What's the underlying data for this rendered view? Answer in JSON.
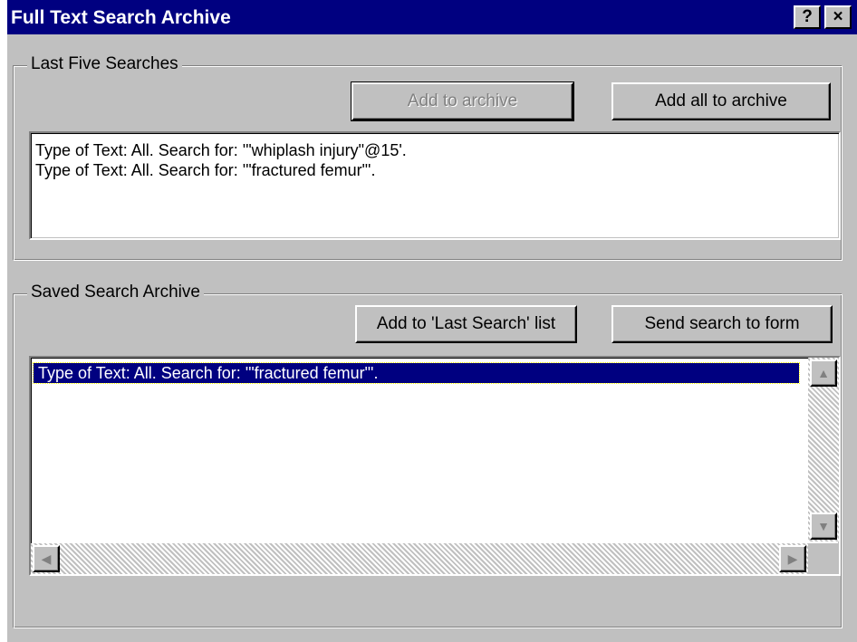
{
  "window": {
    "title": "Full Text Search Archive",
    "help_label": "?",
    "close_label": "×"
  },
  "last_searches": {
    "label": "Last Five Searches",
    "add_button": "Add to archive",
    "add_all_button": "Add all to archive",
    "items": [
      "Type of Text: All. Search for: '\"whiplash injury\"@15'.",
      "Type of Text: All. Search for: '\"fractured femur\"'."
    ]
  },
  "saved_archive": {
    "label": "Saved Search Archive",
    "add_last_button": "Add to 'Last Search' list",
    "send_button": "Send search to form",
    "items": [
      "Type of Text: All. Search for: '\"fractured femur\"'."
    ],
    "selected_index": 0
  },
  "icons": {
    "up": "▲",
    "down": "▼",
    "left": "◀",
    "right": "▶"
  },
  "colors": {
    "titlebar": "#000080",
    "face": "#c0c0c0",
    "selection": "#000080"
  }
}
